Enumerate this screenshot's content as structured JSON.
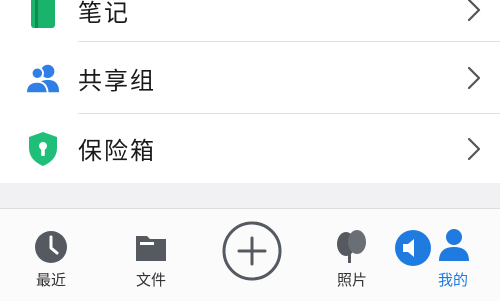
{
  "menu": {
    "items": [
      {
        "label": "笔记",
        "icon": "notebook-icon",
        "icon_color": "#19b36b"
      },
      {
        "label": "共享组",
        "icon": "group-icon",
        "icon_color": "#2f7fe6"
      },
      {
        "label": "保险箱",
        "icon": "safe-shield-icon",
        "icon_color": "#1fbf7a"
      }
    ]
  },
  "tabbar": {
    "tabs": [
      {
        "label": "最近",
        "icon": "clock-icon"
      },
      {
        "label": "文件",
        "icon": "folder-icon"
      },
      {
        "label": "",
        "icon": "plus-circle-icon"
      },
      {
        "label": "照片",
        "icon": "photos-icon"
      },
      {
        "label": "我的",
        "icon": "person-icon",
        "active": true
      }
    ],
    "active_color": "#1f7be0"
  }
}
